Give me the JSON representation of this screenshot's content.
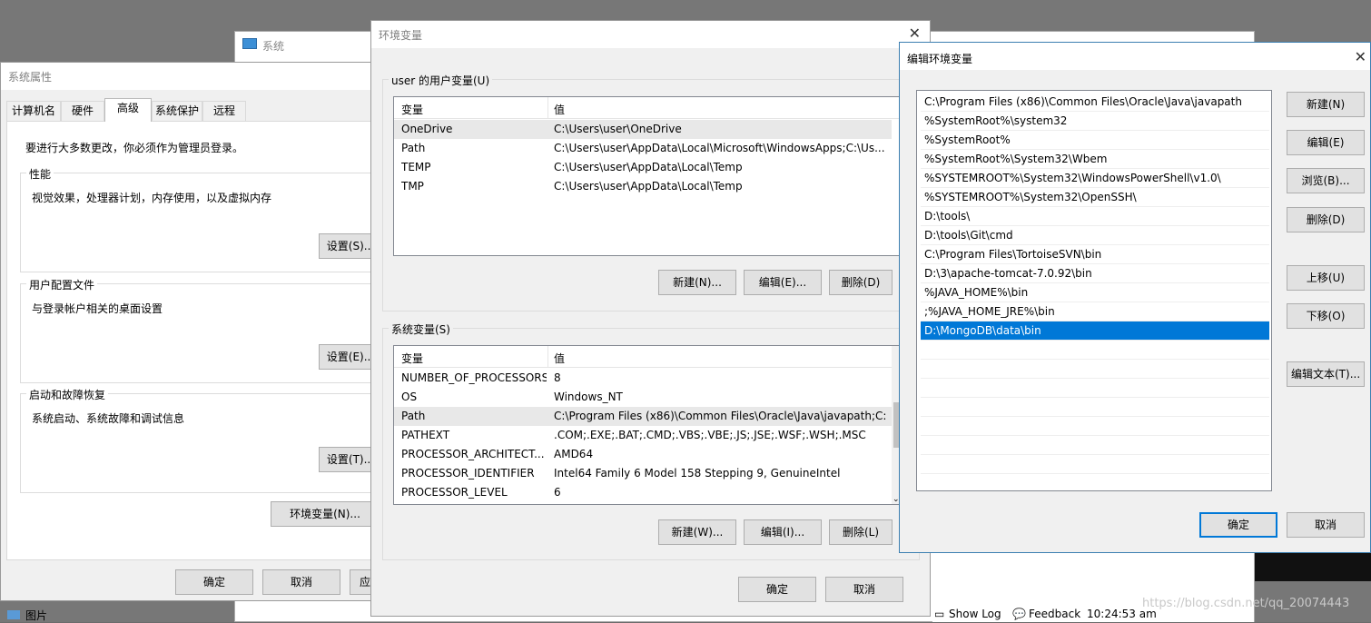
{
  "bg_window": {
    "title": "系统",
    "status": {
      "show_log": "Show Log",
      "feedback": "Feedback",
      "time": "10:24:53 am"
    },
    "watermark": "https://blog.csdn.net/qq_20074443",
    "taskbar_item": "图片"
  },
  "sys_props": {
    "title": "系统属性",
    "tabs": [
      "计算机名",
      "硬件",
      "高级",
      "系统保护",
      "远程"
    ],
    "admin_note": "要进行大多数更改，你必须作为管理员登录。",
    "performance": {
      "legend": "性能",
      "desc": "视觉效果，处理器计划，内存使用，以及虚拟内存",
      "button": "设置(S)..."
    },
    "profiles": {
      "legend": "用户配置文件",
      "desc": "与登录帐户相关的桌面设置",
      "button": "设置(E)..."
    },
    "startup": {
      "legend": "启动和故障恢复",
      "desc": "系统启动、系统故障和调试信息",
      "button": "设置(T)..."
    },
    "env_button": "环境变量(N)...",
    "ok": "确定",
    "cancel": "取消",
    "apply": "应"
  },
  "env_vars": {
    "title": "环境变量",
    "user_group": "user 的用户变量(U)",
    "headers": {
      "var": "变量",
      "val": "值"
    },
    "user_rows": [
      {
        "name": "OneDrive",
        "value": "C:\\Users\\user\\OneDrive"
      },
      {
        "name": "Path",
        "value": "C:\\Users\\user\\AppData\\Local\\Microsoft\\WindowsApps;C:\\Us..."
      },
      {
        "name": "TEMP",
        "value": "C:\\Users\\user\\AppData\\Local\\Temp"
      },
      {
        "name": "TMP",
        "value": "C:\\Users\\user\\AppData\\Local\\Temp"
      }
    ],
    "user_buttons": {
      "new": "新建(N)...",
      "edit": "编辑(E)...",
      "delete": "删除(D)"
    },
    "sys_group": "系统变量(S)",
    "sys_rows": [
      {
        "name": "NUMBER_OF_PROCESSORS",
        "value": "8"
      },
      {
        "name": "OS",
        "value": "Windows_NT"
      },
      {
        "name": "Path",
        "value": "C:\\Program Files (x86)\\Common Files\\Oracle\\Java\\javapath;C:..."
      },
      {
        "name": "PATHEXT",
        "value": ".COM;.EXE;.BAT;.CMD;.VBS;.VBE;.JS;.JSE;.WSF;.WSH;.MSC"
      },
      {
        "name": "PROCESSOR_ARCHITECT...",
        "value": "AMD64"
      },
      {
        "name": "PROCESSOR_IDENTIFIER",
        "value": "Intel64 Family 6 Model 158 Stepping 9, GenuineIntel"
      },
      {
        "name": "PROCESSOR_LEVEL",
        "value": "6"
      }
    ],
    "sys_buttons": {
      "new": "新建(W)...",
      "edit": "编辑(I)...",
      "delete": "删除(L)"
    },
    "ok": "确定",
    "cancel": "取消"
  },
  "edit_env": {
    "title": "编辑环境变量",
    "entries": [
      "C:\\Program Files (x86)\\Common Files\\Oracle\\Java\\javapath",
      "%SystemRoot%\\system32",
      "%SystemRoot%",
      "%SystemRoot%\\System32\\Wbem",
      "%SYSTEMROOT%\\System32\\WindowsPowerShell\\v1.0\\",
      "%SYSTEMROOT%\\System32\\OpenSSH\\",
      "D:\\tools\\",
      "D:\\tools\\Git\\cmd",
      "C:\\Program Files\\TortoiseSVN\\bin",
      "D:\\3\\apache-tomcat-7.0.92\\bin",
      "%JAVA_HOME%\\bin",
      ";%JAVA_HOME_JRE%\\bin",
      "D:\\MongoDB\\data\\bin"
    ],
    "selected_index": 12,
    "buttons": {
      "new": "新建(N)",
      "edit": "编辑(E)",
      "browse": "浏览(B)...",
      "delete": "删除(D)",
      "up": "上移(U)",
      "down": "下移(O)",
      "edit_text": "编辑文本(T)..."
    },
    "ok": "确定",
    "cancel": "取消"
  },
  "colors": {
    "selection": "#0078d7",
    "dialog_bg": "#f0f0f0"
  }
}
